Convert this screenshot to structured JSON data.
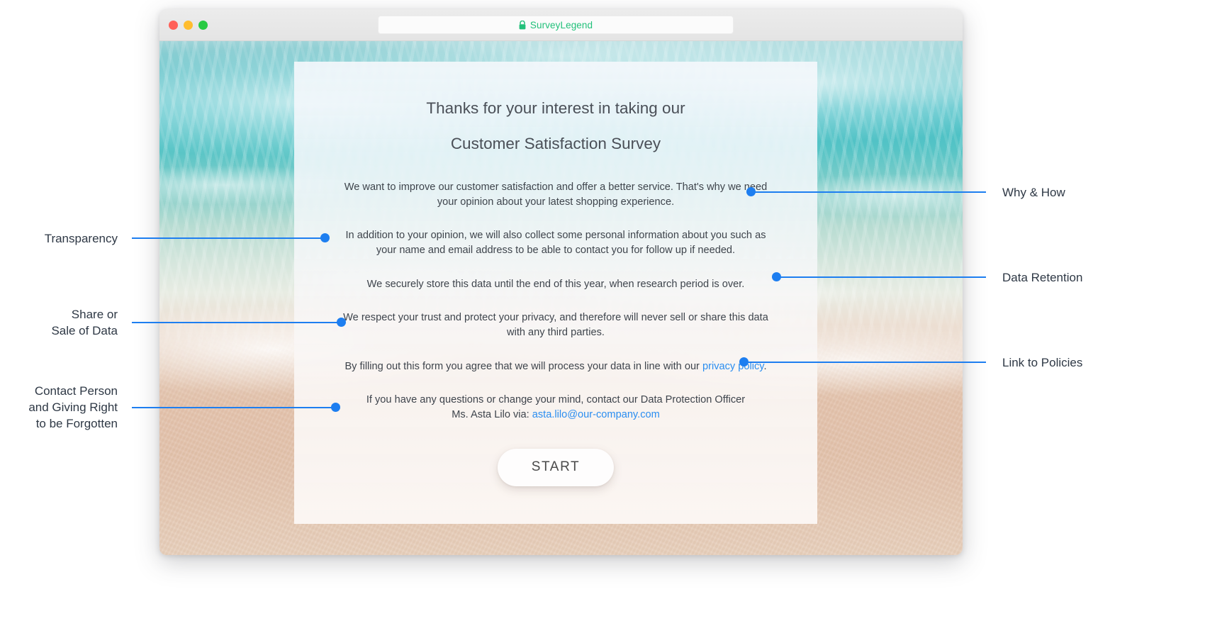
{
  "browser": {
    "traffic_lights": [
      "close",
      "minimize",
      "maximize"
    ],
    "address_bar": {
      "lock_icon": "lock-icon",
      "site_name": "SurveyLegend",
      "lock_color": "#22c07a",
      "text_color": "#22c07a"
    }
  },
  "survey": {
    "title_line_1": "Thanks for your interest in taking our",
    "title_line_2": "Customer Satisfaction Survey",
    "paragraphs": [
      {
        "id": "why-how",
        "text": "We want to improve our customer satisfaction and offer a better service. That's why we need your opinion about your latest shopping experience."
      },
      {
        "id": "transparency",
        "text": "In addition to your opinion, we will also collect some personal information about you such as your name and email address to be able to contact you for follow up if needed."
      },
      {
        "id": "data-retention",
        "text": "We securely store this data until the end of this year, when research period is over."
      },
      {
        "id": "share-or-sale",
        "text": "We respect your trust and protect your privacy, and therefore will never sell or share this data with any third parties."
      }
    ],
    "policy_paragraph": {
      "before": "By filling out this form you agree that we will process your data in line with our ",
      "link": "privacy policy",
      "after": "."
    },
    "contact_paragraph": {
      "line_1": "If you have any questions or change your mind, contact our Data Protection Officer",
      "before": "Ms. Asta Lilo via: ",
      "link": "asta.lilo@our-company.com"
    },
    "start_button_label": "START"
  },
  "annotations": {
    "accent_color": "#1d7ef0",
    "items": [
      {
        "id": "why-how",
        "label": "Why & How",
        "side": "right"
      },
      {
        "id": "transparency",
        "label": "Transparency",
        "side": "left"
      },
      {
        "id": "data-retention",
        "label": "Data Retention",
        "side": "right"
      },
      {
        "id": "share-or-sale",
        "label": "Share or\nSale of Data",
        "side": "left"
      },
      {
        "id": "link-policies",
        "label": "Link to Policies",
        "side": "right"
      },
      {
        "id": "contact-person",
        "label": "Contact Person\nand Giving Right\nto be Forgotten",
        "side": "left"
      }
    ]
  }
}
